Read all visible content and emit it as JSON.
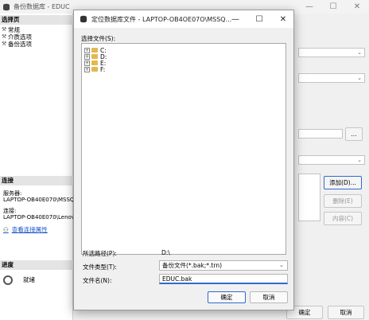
{
  "background_window": {
    "title": "备份数据库 - EDUC",
    "select_page_header": "选择页",
    "nav_items": [
      "常规",
      "介质选项",
      "备份选项"
    ],
    "connection_header": "连接",
    "server_label": "服务器:",
    "server_value": "LAPTOP-OB40E070\\MSSQLS",
    "connection_label": "连接:",
    "connection_value": "LAPTOP-OB40E070\\Lenovo",
    "view_conn_props_link": "查看连接属性",
    "progress_header": "进度",
    "progress_status": "就绪",
    "add_button": "添加(D)...",
    "delete_button": "删除(E)",
    "contents_button": "内容(C)",
    "ok_button": "确定",
    "cancel_button": "取消",
    "browse_button": "..."
  },
  "dialog": {
    "title": "定位数据库文件 - LAPTOP-OB4OE07O\\MSSQ...",
    "select_file_label": "选择文件(S):",
    "drives": [
      "C:",
      "D:",
      "E:",
      "F:"
    ],
    "selected_path_label": "所选路径(P):",
    "selected_path_value": "D:\\",
    "file_type_label": "文件类型(T):",
    "file_type_value": "备份文件(*.bak;*.trn)",
    "file_name_label": "文件名(N):",
    "file_name_value": "EDUC.bak",
    "ok_button": "确定",
    "cancel_button": "取消"
  }
}
